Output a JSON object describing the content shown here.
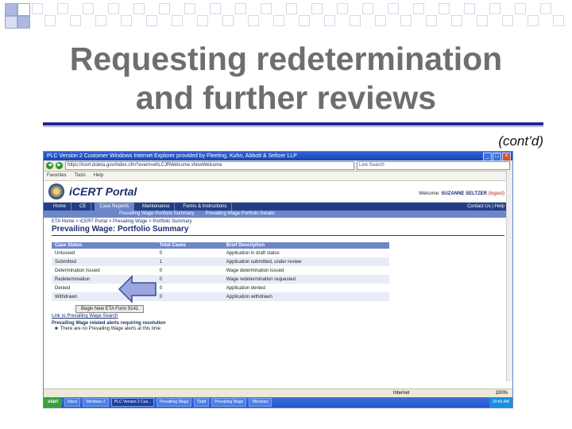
{
  "slide": {
    "title_line1": "Requesting redetermination",
    "title_line2": "and further reviews",
    "contd": "(cont’d)"
  },
  "browser": {
    "window_title": "PLC Version 2 Customer Windows Internet Explorer provided by Fleeting, Kuhn, Abbott & Seltzer LLP",
    "url": "https://icert.doleta.gov/index.cfm?event=ehLCJRWelcome.showWelcome",
    "search_placeholder": "Live Search",
    "favorites": [
      "Favorites",
      "Tools",
      "Help"
    ]
  },
  "portal": {
    "logo_text": "iCERT Portal",
    "welcome_label": "Welcome:",
    "user_name": "SUZANNE SELTZER",
    "logout": "(logout)",
    "nav_tabs": [
      "Home",
      "CE",
      "Case Reports",
      "Maintenance",
      "Forms & Instructions"
    ],
    "active_tab_index": 2,
    "nav_right": "Contact Us | Help",
    "sub_tabs": [
      "Prevailing Wage Portfolio Summary",
      "Prevailing Wage Portfolio Details"
    ],
    "breadcrumb": "ETA Home > iCERT Portal > Prevailing Wage > Portfolio Summary",
    "page_title": "Prevailing Wage: Portfolio Summary"
  },
  "case_table": {
    "headers": [
      "Case Status",
      "Total Cases",
      "Brief Description"
    ],
    "rows": [
      [
        "Unissued",
        "0",
        "Application in draft status"
      ],
      [
        "Submitted",
        "1",
        "Application submitted, under review"
      ],
      [
        "Determination Issued",
        "0",
        "Wage determination issued"
      ],
      [
        "Redetermination",
        "0",
        "Wage redetermination requested"
      ],
      [
        "Denied",
        "0",
        "Application denied"
      ],
      [
        "Withdrawn",
        "0",
        "Application withdrawn"
      ]
    ]
  },
  "actions": {
    "new_button": "Begin New ETA Form 9141",
    "link": "Link to Prevailing Wage Search"
  },
  "alerts": {
    "title": "Prevailing Wage related alerts requiring resolution",
    "items": [
      "There are no Prevailing Wage alerts at this time"
    ]
  },
  "statusbar": {
    "zone": "Internet",
    "zoom": "100%"
  },
  "taskbar": {
    "start": "start",
    "items": [
      "Inbox",
      "Windows 2",
      "PLC Version 2 Cus...",
      "Prevailing Wage",
      "Draft",
      "Prevailing Wage",
      "Windows"
    ],
    "active_index": 2,
    "clock": "10:45 AM"
  },
  "colors": {
    "rule": "#1f2a8a",
    "arrow_fill": "#9aa6dd",
    "arrow_stroke": "#3a4a9a"
  }
}
